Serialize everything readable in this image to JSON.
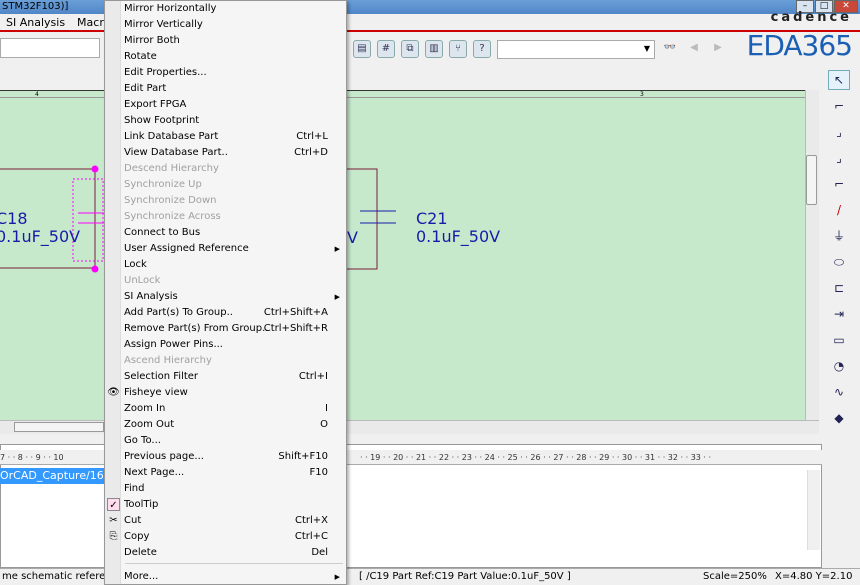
{
  "window": {
    "title": "STM32F103)]"
  },
  "menubar": [
    "SI Analysis",
    "Macro"
  ],
  "logo": {
    "brand": "cadence",
    "text": "EDA365"
  },
  "schematic": {
    "ruler_labels": [
      "4",
      "3"
    ],
    "parts": [
      {
        "ref": "C18",
        "value": "0.1uF_50V"
      },
      {
        "ref": "C21",
        "value": "0.1uF_50V"
      },
      {
        "ref": "C19",
        "value": "V"
      }
    ]
  },
  "context_menu": {
    "items": [
      {
        "label": "Mirror Horizontally"
      },
      {
        "label": "Mirror Vertically"
      },
      {
        "label": "Mirror Both"
      },
      {
        "label": "Rotate"
      },
      {
        "label": "Edit Properties..."
      },
      {
        "label": "Edit Part"
      },
      {
        "label": "Export FPGA"
      },
      {
        "label": "Show Footprint"
      },
      {
        "label": "Link Database Part",
        "shortcut": "Ctrl+L"
      },
      {
        "label": "View Database Part..",
        "shortcut": "Ctrl+D"
      },
      {
        "label": "Descend Hierarchy",
        "disabled": true
      },
      {
        "label": "Synchronize Up",
        "disabled": true
      },
      {
        "label": "Synchronize Down",
        "disabled": true
      },
      {
        "label": "Synchronize Across",
        "disabled": true
      },
      {
        "label": "Connect to Bus"
      },
      {
        "label": "User Assigned Reference",
        "submenu": true
      },
      {
        "label": "Lock"
      },
      {
        "label": "UnLock",
        "disabled": true
      },
      {
        "label": "SI Analysis",
        "submenu": true
      },
      {
        "label": "Add Part(s) To Group..",
        "shortcut": "Ctrl+Shift+A"
      },
      {
        "label": "Remove Part(s) From Group..",
        "shortcut": "Ctrl+Shift+R"
      },
      {
        "label": "Assign Power Pins..."
      },
      {
        "label": "Ascend Hierarchy",
        "disabled": true
      },
      {
        "label": "Selection Filter",
        "shortcut": "Ctrl+I"
      },
      {
        "label": "Fisheye view",
        "icon": "eye-icon"
      },
      {
        "label": "Zoom In",
        "shortcut": "I"
      },
      {
        "label": "Zoom Out",
        "shortcut": "O"
      },
      {
        "label": "Go To..."
      },
      {
        "label": "Previous page...",
        "shortcut": "Shift+F10"
      },
      {
        "label": "Next Page...",
        "shortcut": "F10"
      },
      {
        "label": "Find"
      },
      {
        "label": "ToolTip",
        "icon": "checkmark-icon",
        "checked": true
      },
      {
        "label": "Cut",
        "shortcut": "Ctrl+X",
        "icon": "scissors-icon"
      },
      {
        "label": "Copy",
        "shortcut": "Ctrl+C",
        "icon": "copy-icon"
      },
      {
        "label": "Delete",
        "shortcut": "Del"
      },
      {
        "label": "More...",
        "submenu": true,
        "separator_before": true
      }
    ]
  },
  "session_log": {
    "ruler": "7 · · 8 · · 9 · · 10",
    "ruler_right": "· · 19 · · 20 · · 21 · · 22 · · 23 · · 24 · · 25 · · 26 · · 27 · · 28 · · 29 · · 30 · · 31 · · 32 · · 33 · ·",
    "selected_line": "OrCAD_Capture/16"
  },
  "status": {
    "left": "me schematic referen",
    "part": "[ /C19 Part Ref:C19 Part Value:0.1uF_50V ]",
    "scale": "Scale=250%",
    "coords": "X=4.80  Y=2.10"
  },
  "colors": {
    "canvas": "#c6e9cc",
    "selection": "#ff00ff",
    "wire": "#7a1e3c",
    "part": "#1a1aaa",
    "accent_red": "#cc0000"
  }
}
